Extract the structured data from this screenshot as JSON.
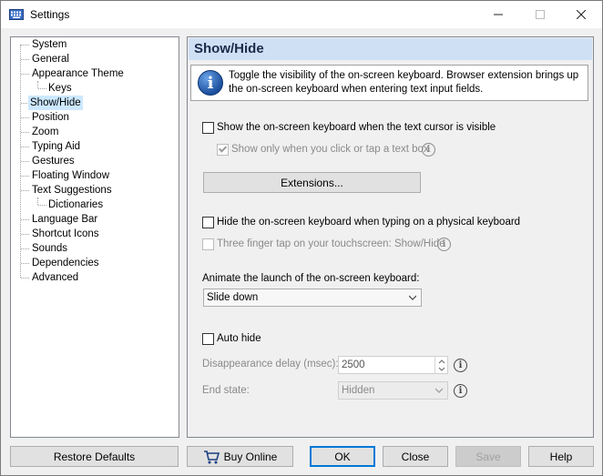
{
  "window": {
    "title": "Settings"
  },
  "tree": {
    "items": [
      {
        "label": "System"
      },
      {
        "label": "General"
      },
      {
        "label": "Appearance Theme"
      },
      {
        "label": "Keys"
      },
      {
        "label": "Show/Hide"
      },
      {
        "label": "Position"
      },
      {
        "label": "Zoom"
      },
      {
        "label": "Typing Aid"
      },
      {
        "label": "Gestures"
      },
      {
        "label": "Floating Window"
      },
      {
        "label": "Text Suggestions"
      },
      {
        "label": "Dictionaries"
      },
      {
        "label": "Language Bar"
      },
      {
        "label": "Shortcut Icons"
      },
      {
        "label": "Sounds"
      },
      {
        "label": "Dependencies"
      },
      {
        "label": "Advanced"
      }
    ],
    "selected": "Show/Hide"
  },
  "panel": {
    "title": "Show/Hide",
    "info": "Toggle the visibility of the on-screen keyboard. Browser extension brings up the on-screen keyboard when entering text input fields.",
    "show_on_cursor": {
      "label": "Show the on-screen keyboard when the text cursor is visible",
      "checked": false
    },
    "show_only_click": {
      "label": "Show only when you click or tap a text box",
      "checked": true,
      "enabled": false
    },
    "extensions_button": "Extensions...",
    "hide_physical": {
      "label": "Hide the on-screen keyboard when typing on a physical keyboard",
      "checked": false
    },
    "three_finger": {
      "label": "Three finger tap on your touchscreen: Show/Hide",
      "checked": false,
      "enabled": false
    },
    "animate_label": "Animate the launch of the on-screen keyboard:",
    "animate_value": "Slide down",
    "auto_hide": {
      "label": "Auto hide",
      "checked": false
    },
    "delay_label": "Disappearance delay (msec):",
    "delay_value": "2500",
    "end_state_label": "End state:",
    "end_state_value": "Hidden"
  },
  "buttons": {
    "restore": "Restore Defaults",
    "buy": "Buy Online",
    "ok": "OK",
    "close": "Close",
    "save": "Save",
    "help": "Help"
  },
  "colors": {
    "selection": "#cce8ff",
    "header": "#cfe0f5",
    "accent": "#0078d7"
  }
}
